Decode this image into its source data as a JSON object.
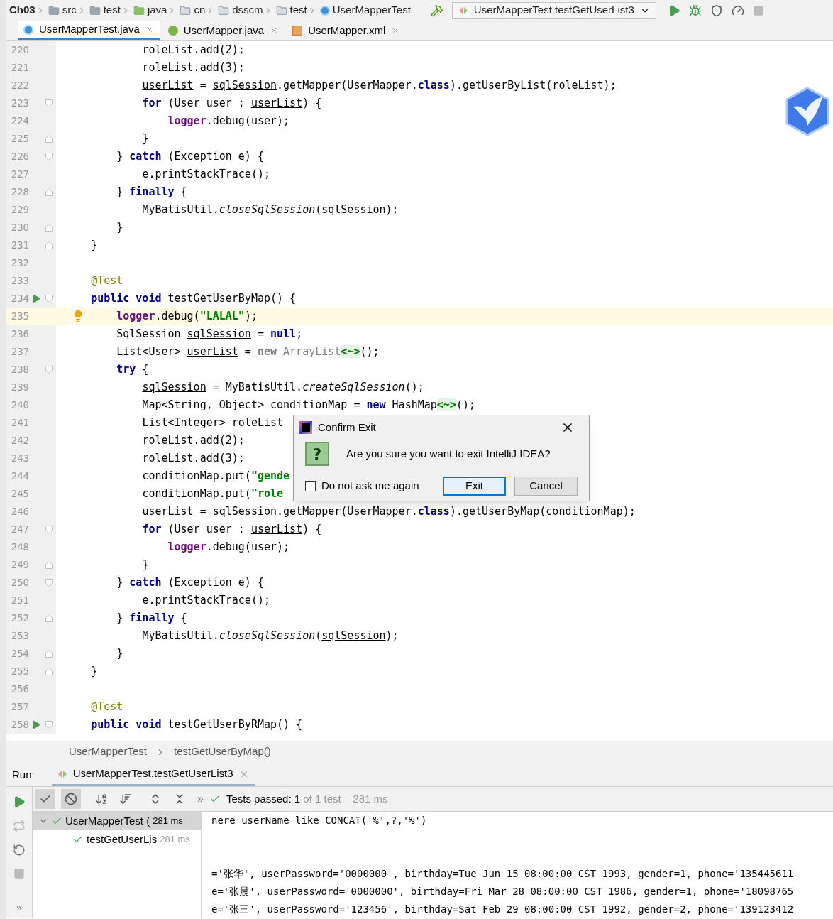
{
  "navbar": {
    "breadcrumbs": [
      {
        "label": "Ch03",
        "kind": "project"
      },
      {
        "label": "src",
        "kind": "folder"
      },
      {
        "label": "test",
        "kind": "folder"
      },
      {
        "label": "java",
        "kind": "source"
      },
      {
        "label": "cn",
        "kind": "package"
      },
      {
        "label": "dsscm",
        "kind": "package"
      },
      {
        "label": "test",
        "kind": "package"
      },
      {
        "label": "UserMapperTest",
        "kind": "class"
      }
    ],
    "run_config": "UserMapperTest.testGetUserList3"
  },
  "tabs": [
    {
      "label": "UserMapperTest.java",
      "kind": "class",
      "selected": true
    },
    {
      "label": "UserMapper.java",
      "kind": "interface",
      "selected": false
    },
    {
      "label": "UserMapper.xml",
      "kind": "xml",
      "selected": false
    }
  ],
  "editor": {
    "lines": [
      {
        "number": "220",
        "tokens": [
          {
            "kind": "plain",
            "text": "            roleList.add(2);"
          }
        ]
      },
      {
        "number": "221",
        "tokens": [
          {
            "kind": "plain",
            "text": "            roleList.add(3);"
          }
        ]
      },
      {
        "number": "222",
        "tokens": [
          {
            "kind": "var",
            "text": "            userList"
          },
          {
            "kind": "plain",
            "text": " = "
          },
          {
            "kind": "var",
            "text": "sqlSession"
          },
          {
            "kind": "plain",
            "text": ".getMapper(UserMapper."
          },
          {
            "kind": "kw",
            "text": "class"
          },
          {
            "kind": "plain",
            "text": ").getUserByList(roleList);"
          }
        ]
      },
      {
        "number": "223",
        "fold_start": true,
        "tokens": [
          {
            "kind": "kw",
            "text": "            for"
          },
          {
            "kind": "plain",
            "text": " (User user : "
          },
          {
            "kind": "var",
            "text": "userList"
          },
          {
            "kind": "plain",
            "text": ") {"
          }
        ]
      },
      {
        "number": "224",
        "tokens": [
          {
            "kind": "field",
            "text": "                logger"
          },
          {
            "kind": "plain",
            "text": ".debug(user);"
          }
        ]
      },
      {
        "number": "225",
        "fold_end": true,
        "tokens": [
          {
            "kind": "plain",
            "text": "            }"
          }
        ]
      },
      {
        "number": "226",
        "fold_start": true,
        "tokens": [
          {
            "kind": "plain",
            "text": "        } "
          },
          {
            "kind": "kw",
            "text": "catch"
          },
          {
            "kind": "plain",
            "text": " (Exception e) {"
          }
        ]
      },
      {
        "number": "227",
        "tokens": [
          {
            "kind": "plain",
            "text": "            e.printStackTrace();"
          }
        ]
      },
      {
        "number": "228",
        "fold_end": true,
        "tokens": [
          {
            "kind": "plain",
            "text": "        } "
          },
          {
            "kind": "kw",
            "text": "finally"
          },
          {
            "kind": "plain",
            "text": " {"
          }
        ]
      },
      {
        "number": "229",
        "tokens": [
          {
            "kind": "plain",
            "text": "            MyBatisUtil."
          },
          {
            "kind": "static",
            "text": "closeSqlSession"
          },
          {
            "kind": "plain",
            "text": "("
          },
          {
            "kind": "var",
            "text": "sqlSession"
          },
          {
            "kind": "plain",
            "text": ");"
          }
        ]
      },
      {
        "number": "230",
        "fold_end": true,
        "tokens": [
          {
            "kind": "plain",
            "text": "        }"
          }
        ]
      },
      {
        "number": "231",
        "fold_end": true,
        "tokens": [
          {
            "kind": "plain",
            "text": "    }"
          }
        ]
      },
      {
        "number": "232"
      },
      {
        "number": "233",
        "tokens": [
          {
            "kind": "ann",
            "text": "    @Test"
          }
        ]
      },
      {
        "number": "234",
        "fold_start": true,
        "runnable": true,
        "tokens": [
          {
            "kind": "kw",
            "text": "    public void"
          },
          {
            "kind": "plain",
            "text": " testGetUserByMap() {"
          }
        ]
      },
      {
        "number": "235",
        "intention": true,
        "current": true,
        "tokens": [
          {
            "kind": "field",
            "text": "        logger"
          },
          {
            "kind": "plain",
            "text": ".debug("
          },
          {
            "kind": "str",
            "text": "\"LALAL\""
          },
          {
            "kind": "plain",
            "text": ");"
          }
        ]
      },
      {
        "number": "236",
        "tokens": [
          {
            "kind": "plain",
            "text": "        SqlSession "
          },
          {
            "kind": "var",
            "text": "sqlSession"
          },
          {
            "kind": "plain",
            "text": " = "
          },
          {
            "kind": "kw",
            "text": "null"
          },
          {
            "kind": "plain",
            "text": ";"
          }
        ]
      },
      {
        "number": "237",
        "tokens": [
          {
            "kind": "plain",
            "text": "        List<User> "
          },
          {
            "kind": "var",
            "text": "userList"
          },
          {
            "kind": "plain",
            "text": " = "
          },
          {
            "kind": "graykw",
            "text": "new"
          },
          {
            "kind": "gray",
            "text": " ArrayList"
          },
          {
            "kind": "diamond",
            "text": "<~>"
          },
          {
            "kind": "plain",
            "text": "();"
          }
        ]
      },
      {
        "number": "238",
        "fold_start": true,
        "tokens": [
          {
            "kind": "kw",
            "text": "        try"
          },
          {
            "kind": "plain",
            "text": " {"
          }
        ]
      },
      {
        "number": "239",
        "tokens": [
          {
            "kind": "var",
            "text": "            sqlSession"
          },
          {
            "kind": "plain",
            "text": " = MyBatisUtil."
          },
          {
            "kind": "static",
            "text": "createSqlSession"
          },
          {
            "kind": "plain",
            "text": "();"
          }
        ]
      },
      {
        "number": "240",
        "tokens": [
          {
            "kind": "plain",
            "text": "            Map<String, Object> conditionMap = "
          },
          {
            "kind": "kw",
            "text": "new"
          },
          {
            "kind": "plain",
            "text": " HashMap"
          },
          {
            "kind": "diamond",
            "text": "<~>"
          },
          {
            "kind": "plain",
            "text": "();"
          }
        ]
      },
      {
        "number": "241",
        "tokens": [
          {
            "kind": "plain",
            "text": "            List<Integer> roleList"
          }
        ]
      },
      {
        "number": "242",
        "tokens": [
          {
            "kind": "plain",
            "text": "            roleList.add(2);"
          }
        ]
      },
      {
        "number": "243",
        "tokens": [
          {
            "kind": "plain",
            "text": "            roleList.add(3);"
          }
        ]
      },
      {
        "number": "244",
        "tokens": [
          {
            "kind": "plain",
            "text": "            conditionMap.put("
          },
          {
            "kind": "str",
            "text": "\"gende"
          }
        ]
      },
      {
        "number": "245",
        "tokens": [
          {
            "kind": "plain",
            "text": "            conditionMap.put("
          },
          {
            "kind": "str",
            "text": "\"role"
          }
        ]
      },
      {
        "number": "246",
        "tokens": [
          {
            "kind": "var",
            "text": "            userList"
          },
          {
            "kind": "plain",
            "text": " = "
          },
          {
            "kind": "var",
            "text": "sqlSession"
          },
          {
            "kind": "plain",
            "text": ".getMapper(UserMapper."
          },
          {
            "kind": "kw",
            "text": "class"
          },
          {
            "kind": "plain",
            "text": ").getUserByMap(conditionMap);"
          }
        ]
      },
      {
        "number": "247",
        "fold_start": true,
        "tokens": [
          {
            "kind": "kw",
            "text": "            for"
          },
          {
            "kind": "plain",
            "text": " (User user : "
          },
          {
            "kind": "var",
            "text": "userList"
          },
          {
            "kind": "plain",
            "text": ") {"
          }
        ]
      },
      {
        "number": "248",
        "tokens": [
          {
            "kind": "field",
            "text": "                logger"
          },
          {
            "kind": "plain",
            "text": ".debug(user);"
          }
        ]
      },
      {
        "number": "249",
        "fold_end": true,
        "tokens": [
          {
            "kind": "plain",
            "text": "            }"
          }
        ]
      },
      {
        "number": "250",
        "fold_start": true,
        "tokens": [
          {
            "kind": "plain",
            "text": "        } "
          },
          {
            "kind": "kw",
            "text": "catch"
          },
          {
            "kind": "plain",
            "text": " (Exception e) {"
          }
        ]
      },
      {
        "number": "251",
        "tokens": [
          {
            "kind": "plain",
            "text": "            e.printStackTrace();"
          }
        ]
      },
      {
        "number": "252",
        "fold_end": true,
        "tokens": [
          {
            "kind": "plain",
            "text": "        } "
          },
          {
            "kind": "kw",
            "text": "finally"
          },
          {
            "kind": "plain",
            "text": " {"
          }
        ]
      },
      {
        "number": "253",
        "tokens": [
          {
            "kind": "plain",
            "text": "            MyBatisUtil."
          },
          {
            "kind": "static",
            "text": "closeSqlSession"
          },
          {
            "kind": "plain",
            "text": "("
          },
          {
            "kind": "var",
            "text": "sqlSession"
          },
          {
            "kind": "plain",
            "text": ");"
          }
        ]
      },
      {
        "number": "254",
        "fold_end": true,
        "tokens": [
          {
            "kind": "plain",
            "text": "        }"
          }
        ]
      },
      {
        "number": "255",
        "fold_end": true,
        "tokens": [
          {
            "kind": "plain",
            "text": "    }"
          }
        ]
      },
      {
        "number": "256"
      },
      {
        "number": "257",
        "tokens": [
          {
            "kind": "ann",
            "text": "    @Test"
          }
        ]
      },
      {
        "number": "258",
        "fold_start": true,
        "runnable": true,
        "tokens": [
          {
            "kind": "kw",
            "text": "    public void"
          },
          {
            "kind": "plain",
            "text": " testGetUserByRMap() {"
          }
        ]
      }
    ],
    "breadcrumb": [
      "UserMapperTest",
      "testGetUserByMap()"
    ]
  },
  "dialog": {
    "title": "Confirm Exit",
    "icon_glyph": "?",
    "message": "Are you sure you want to exit IntelliJ IDEA?",
    "checkbox": {
      "label": "Do not ask me again",
      "checked": false
    },
    "buttons": [
      {
        "label": "Exit",
        "selected": true
      },
      {
        "label": "Cancel",
        "selected": false
      }
    ]
  },
  "run_panel": {
    "label": "Run:",
    "tab": "UserMapperTest.testGetUserList3",
    "toggles": [
      {
        "kind": "passed",
        "on": true
      },
      {
        "kind": "ignored",
        "on": true
      }
    ],
    "more": "»",
    "status": {
      "head": "Tests passed:",
      "count": "1",
      "rest": "of 1 test – 281 ms"
    },
    "tree": [
      {
        "name": "UserMapperTest (",
        "time": "281 ms",
        "selected": true,
        "expanded": true,
        "children": [
          {
            "name": "testGetUserLis",
            "time": "281 ms",
            "selected": false
          }
        ]
      }
    ],
    "side_more": "»",
    "console": [
      {
        "text": "nere userName like CONCAT('%',?,'%')"
      },
      {
        "gap_before": true,
        "text": "='张华', userPassword='0000000', birthday=Tue Jun 15 08:00:00 CST 1993, gender=1, phone='135445611"
      },
      {
        "text": "e='张晨', userPassword='0000000', birthday=Fri Mar 28 08:00:00 CST 1986, gender=1, phone='18098765"
      },
      {
        "text": "e='张三', userPassword='123456', birthday=Sat Feb 29 08:00:00 CST 1992, gender=2, phone='139123412"
      }
    ]
  }
}
